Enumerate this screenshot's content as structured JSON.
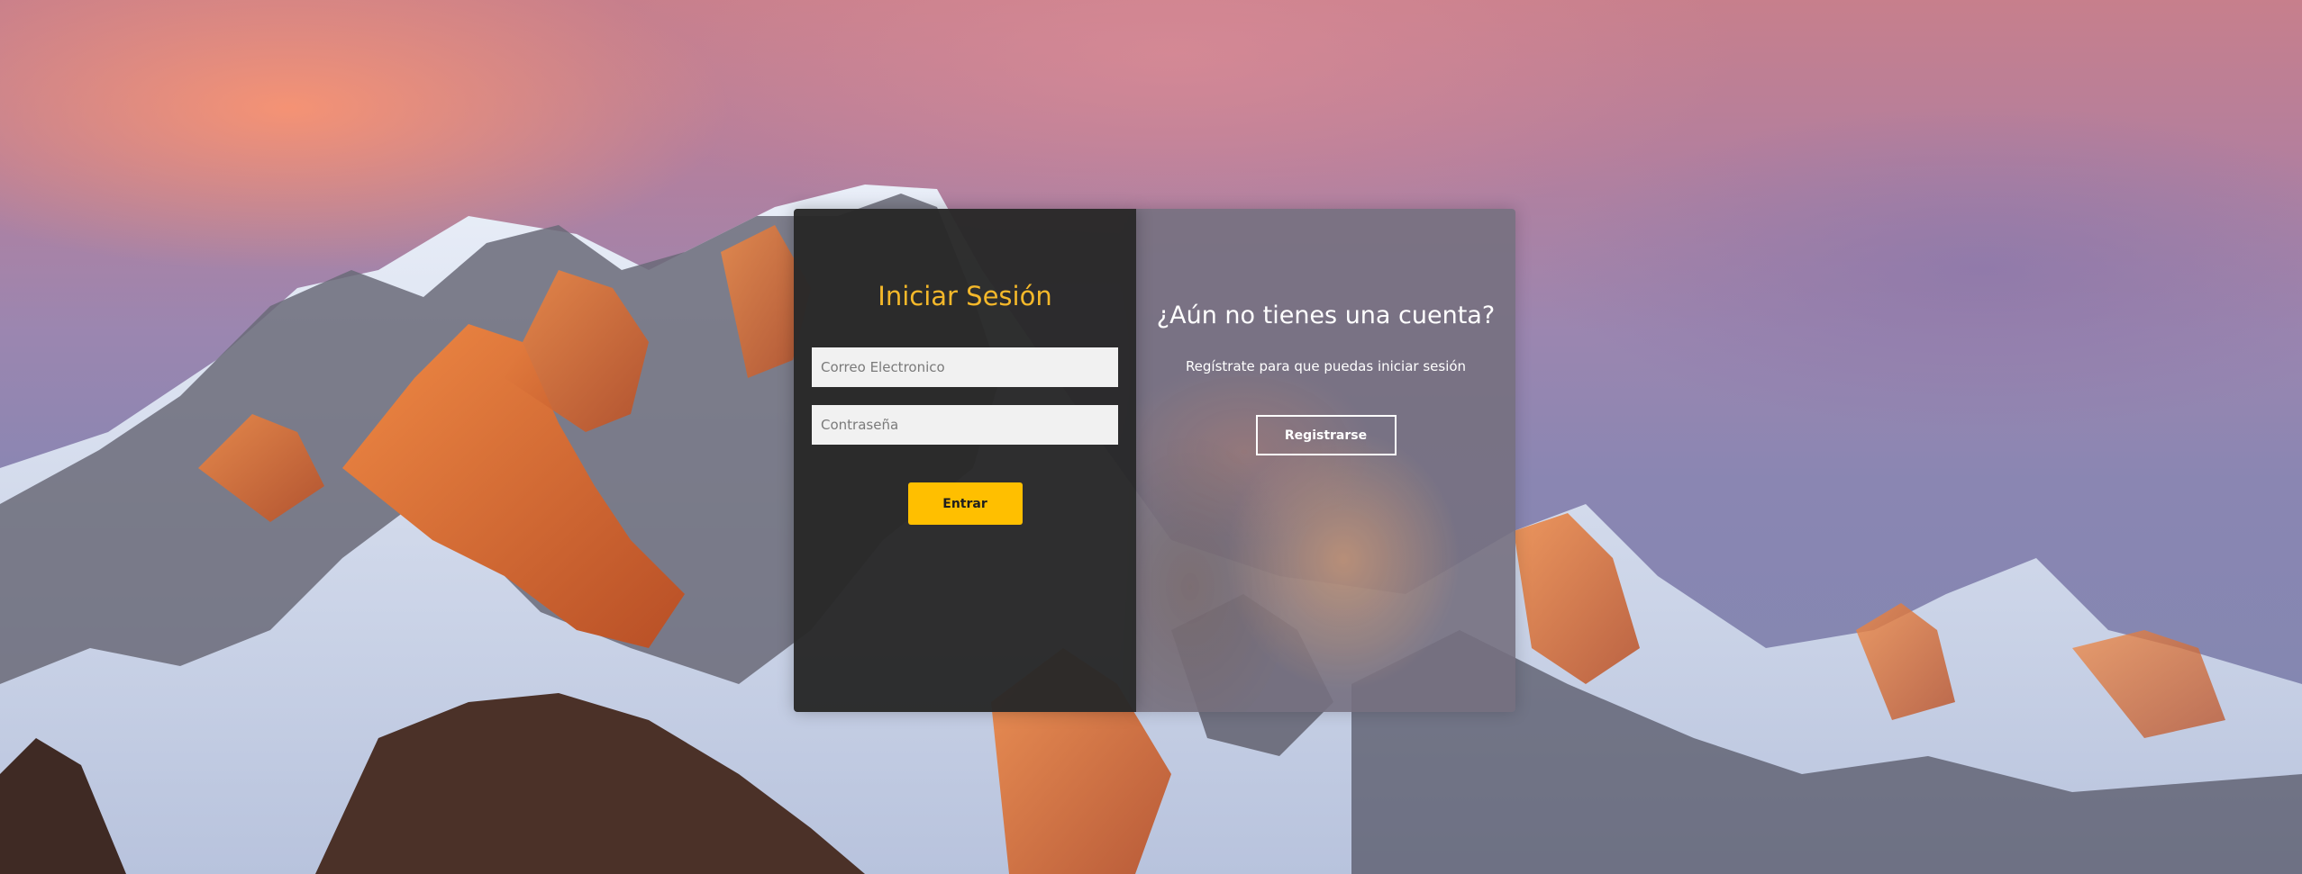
{
  "login": {
    "title": "Iniciar Sesión",
    "email_placeholder": "Correo Electronico",
    "password_placeholder": "Contraseña",
    "submit_label": "Entrar"
  },
  "register": {
    "heading": "¿Aún no tienes una cuenta?",
    "description": "Regístrate para que puedas iniciar sesión",
    "button_label": "Registrarse"
  },
  "colors": {
    "accent": "#ffbf00",
    "title": "#f4b82a",
    "login_panel_bg": "#282828"
  }
}
